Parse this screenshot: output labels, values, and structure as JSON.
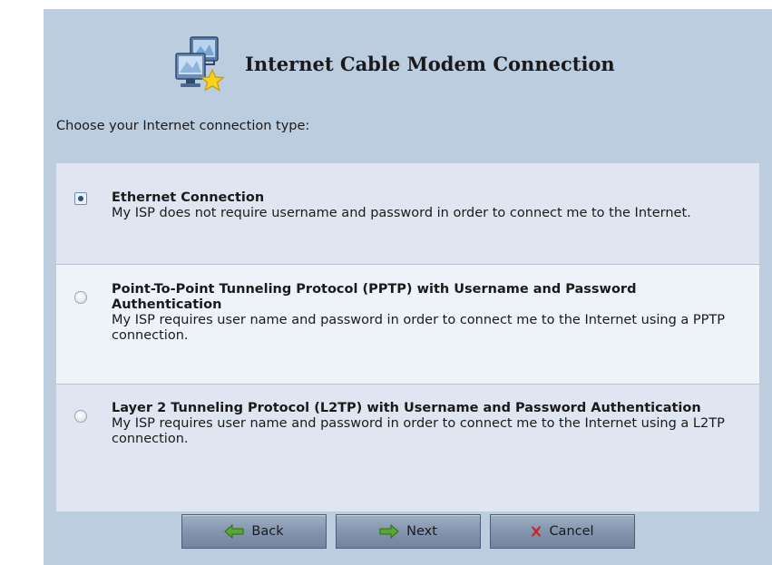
{
  "header": {
    "title": "Internet Cable Modem Connection",
    "icon": "network-computers-star-icon"
  },
  "prompt": "Choose your Internet connection type:",
  "options": [
    {
      "title": "Ethernet Connection",
      "description": "My ISP does not require username and password in order to connect me to the Internet.",
      "selected": true
    },
    {
      "title": "Point-To-Point Tunneling Protocol (PPTP) with Username and Password Authentication",
      "description": "My ISP requires user name and password in order to connect me to the Internet using a PPTP connection.",
      "selected": false
    },
    {
      "title": "Layer 2 Tunneling Protocol (L2TP) with Username and Password Authentication",
      "description": "My ISP requires user name and password in order to connect me to the Internet using a L2TP connection.",
      "selected": false
    }
  ],
  "buttons": {
    "back_label": "Back",
    "next_label": "Next",
    "cancel_label": "Cancel"
  },
  "colors": {
    "panel_bg": "#bccde0",
    "option_bg": "#dfe6f2",
    "option_alt_bg": "#eef2f9",
    "button_bg": "#8395ae",
    "arrow_green": "#5aa832",
    "cancel_red": "#cc2222"
  }
}
